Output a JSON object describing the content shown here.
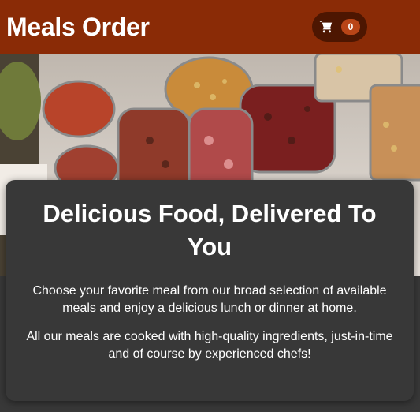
{
  "header": {
    "title": "Meals Order",
    "cart": {
      "icon": "shopping-cart-icon",
      "count": "0"
    }
  },
  "banner": {
    "image": "meals-buffet-table-photo"
  },
  "summary": {
    "title": "Delicious Food, Delivered To You",
    "paragraph_1": "Choose your favorite meal from our broad selection of available meals and enjoy a delicious lunch or dinner at home.",
    "paragraph_2": "All our meals are cooked with high-quality ingredients, just-in-time and of course by experienced chefs!"
  },
  "colors": {
    "header_bg": "#8a2b06",
    "cart_button_bg": "#4d1601",
    "badge_bg": "#b94517",
    "page_bg": "#383838"
  }
}
